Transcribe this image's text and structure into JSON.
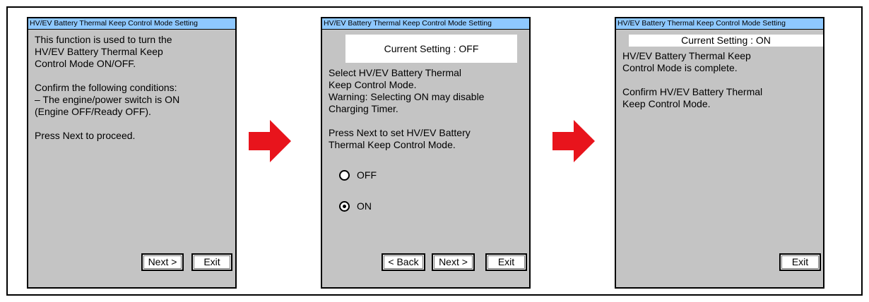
{
  "panels": [
    {
      "title": "HV/EV Battery Thermal Keep Control Mode Setting",
      "body": "This function is used to turn the\nHV/EV Battery Thermal Keep\nControl Mode ON/OFF.\n\nConfirm the following conditions:\n– The engine/power switch is ON\n(Engine OFF/Ready OFF).\n\nPress Next to proceed.",
      "next_label": "Next >",
      "exit_label": "Exit"
    },
    {
      "title": "HV/EV Battery Thermal Keep Control Mode Setting",
      "current_setting": "Current Setting : OFF",
      "body": "Select HV/EV Battery Thermal\nKeep Control Mode.\nWarning: Selecting ON may disable\nCharging Timer.\n\nPress Next to set  HV/EV Battery\nThermal Keep Control Mode.",
      "options": [
        {
          "label": "OFF",
          "selected": false
        },
        {
          "label": "ON",
          "selected": true
        }
      ],
      "back_label": "< Back",
      "next_label": "Next >",
      "exit_label": "Exit"
    },
    {
      "title": "HV/EV Battery Thermal Keep Control Mode Setting",
      "current_setting": "Current Setting : ON",
      "body": "HV/EV Battery Thermal Keep\nControl Mode is complete.\n\nConfirm HV/EV Battery Thermal\nKeep Control Mode.",
      "exit_label": "Exit"
    }
  ],
  "colors": {
    "panel_bg": "#c4c4c4",
    "title_bar": "#8ec8ff",
    "arrow": "#e8141c"
  }
}
